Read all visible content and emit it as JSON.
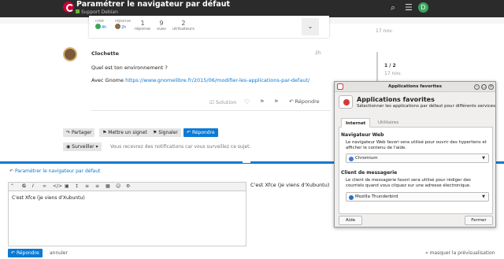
{
  "header": {
    "title": "Paramétrer le navigateur par défaut",
    "crumb": "Support Debian",
    "avatar": "D"
  },
  "topic_stats": {
    "created_label": "créé",
    "created": "4h",
    "reply_label": "réponse",
    "reply": "2h",
    "replies_n": "1",
    "replies_label": "réponse",
    "views_n": "9",
    "views_label": "vues",
    "users_n": "2",
    "users_label": "utilisateurs"
  },
  "post": {
    "author": "Clochette",
    "time": "2h",
    "line1": "Quel est ton environnement ?",
    "line2_pre": "Avec Gnome ",
    "link": "https://www.gnomelibre.fr/2015/06/modifier-les-applications-par-defaut/",
    "solution": "Solution",
    "reply": "Répondre"
  },
  "timeline": {
    "date_top": "17 nov.",
    "pos": "1 / 2",
    "date": "17 nov."
  },
  "actions": {
    "share": "Partager",
    "bookmark": "Mettre un signet",
    "flag": "Signaler",
    "reply": "Répondre"
  },
  "notif": {
    "level": "Surveiller",
    "text": "Vous recevrez des notifications car vous surveillez ce sujet."
  },
  "composer": {
    "title": "Paramétrer le navigateur par défaut",
    "text": "C'est Xfce (je viens d'Xubuntu)",
    "preview": "C'est Xfce (je viens d'Xubuntu)",
    "reply": "Répondre",
    "cancel": "annuler",
    "hide_preview": "« masquer la prévisualisation"
  },
  "dialog": {
    "window_title": "Applications favorites",
    "heading": "Applications favorites",
    "subtitle": "Sélectionner les applications par défaut pour différents services",
    "tab_internet": "Internet",
    "tab_utilities": "Utilitaires",
    "web_title": "Navigateur Web",
    "web_desc": "Le navigateur Web favori sera utilisé pour ouvrir des hyperliens et afficher le contenu de l'aide.",
    "web_value": "Chromium",
    "mail_title": "Client de messagerie",
    "mail_desc": "Le client de messagerie favori sera utilisé pour rédiger des courriels quand vous cliquez sur une adresse électronique.",
    "mail_value": "Mozilla Thunderbird",
    "help": "Aide",
    "close": "Fermer"
  },
  "colors": {
    "accent": "#0a7ad4",
    "header": "#2b2b2b",
    "debian_red": "#c70036"
  }
}
